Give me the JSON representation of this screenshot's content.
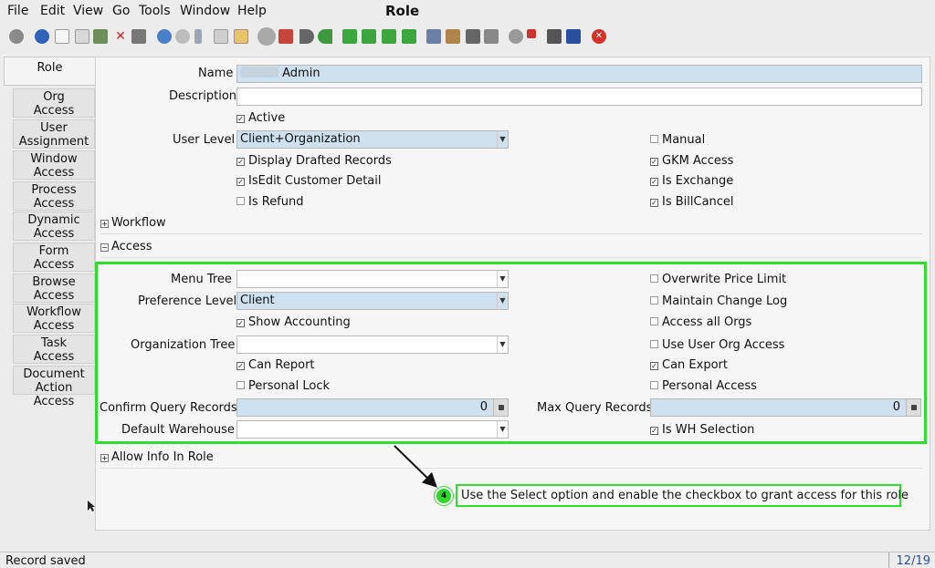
{
  "menu": {
    "file": "File",
    "edit": "Edit",
    "view": "View",
    "go": "Go",
    "tools": "Tools",
    "window": "Window",
    "help": "Help"
  },
  "window_title": "Role",
  "toolbar_icons": [
    "undo-icon",
    "help-icon",
    "new-icon",
    "copy-icon",
    "save-icon",
    "delete-icon",
    "print-preview-icon",
    "refresh-icon",
    "find-icon",
    "attachment-icon",
    "chat-icon",
    "history-icon",
    "home-icon",
    "parent-icon",
    "back-icon",
    "forward-icon",
    "first-icon",
    "previous-icon",
    "next-icon",
    "last-icon",
    "report-icon",
    "archive-icon",
    "print-icon",
    "print-all-icon",
    "zoom-icon",
    "workflow-icon",
    "product-icon",
    "request-icon",
    "exit-icon"
  ],
  "side_tabs": {
    "role": "Role",
    "org_access": [
      "Org",
      "Access"
    ],
    "user_assignment": [
      "User",
      "Assignment"
    ],
    "window_access": [
      "Window",
      "Access"
    ],
    "process_access": [
      "Process",
      "Access"
    ],
    "dynamic_access": [
      "Dynamic",
      "Access"
    ],
    "form_access": [
      "Form",
      "Access"
    ],
    "browse_access": [
      "Browse",
      "Access"
    ],
    "workflow_access": [
      "Workflow",
      "Access"
    ],
    "task_access": [
      "Task",
      "Access"
    ],
    "document_action_access": [
      "Document",
      "Action Access"
    ]
  },
  "form": {
    "name_label": "Name",
    "name_value": "Admin",
    "description_label": "Description",
    "description_value": "",
    "active": "Active",
    "user_level_label": "User Level",
    "user_level_value": "Client+Organization",
    "display_drafted_records": "Display Drafted Records",
    "isedit_customer_detail": "IsEdit Customer Detail",
    "is_refund": "Is Refund",
    "manual": "Manual",
    "gkm_access": "GKM Access",
    "is_exchange": "Is Exchange",
    "is_billcancel": "Is BillCancel"
  },
  "sections": {
    "workflow": "Workflow",
    "access": "Access",
    "allow_info_in_role": "Allow Info In Role"
  },
  "access": {
    "menu_tree_label": "Menu Tree",
    "menu_tree_value": "",
    "preference_level_label": "Preference Level",
    "preference_level_value": "Client",
    "show_accounting": "Show Accounting",
    "organization_tree_label": "Organization Tree",
    "organization_tree_value": "",
    "can_report": "Can Report",
    "personal_lock": "Personal Lock",
    "confirm_query_records_label": "Confirm Query Records",
    "confirm_query_records_value": "0",
    "default_warehouse_label": "Default Warehouse",
    "default_warehouse_value": "",
    "overwrite_price_limit": "Overwrite Price Limit",
    "maintain_change_log": "Maintain Change Log",
    "access_all_orgs": "Access all Orgs",
    "use_user_org_access": "Use User Org Access",
    "can_export": "Can Export",
    "personal_access": "Personal Access",
    "max_query_records_label": "Max Query Records",
    "max_query_records_value": "0",
    "is_wh_selection": "Is WH Selection"
  },
  "annotation": {
    "step": "4",
    "text": "Use the Select option and enable the checkbox to grant access for this role"
  },
  "status": {
    "message": "Record saved",
    "record_count": "12/19"
  },
  "colors": {
    "highlight_green": "#2fdc2f",
    "field_blue": "#cfe0ef"
  }
}
